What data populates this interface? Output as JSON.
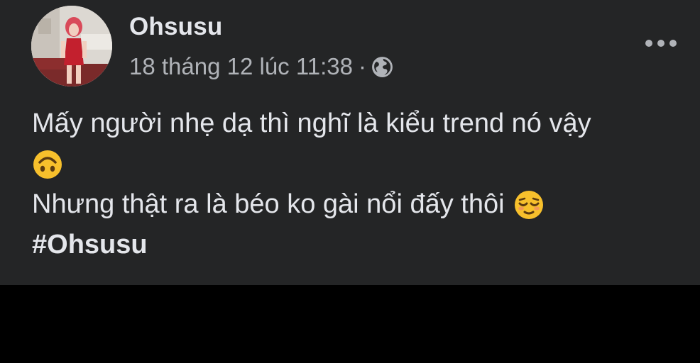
{
  "post": {
    "author": "Ohsusu",
    "timestamp": "18 tháng 12 lúc 11:38",
    "separator": "·",
    "privacy_icon": "globe-icon",
    "more_icon": "more-options-icon",
    "text_line_1": "Mấy người nhẹ dạ thì nghĩ là kiểu trend nó vậy",
    "emoji_1": "upside-down-face",
    "text_line_3": "Nhưng thật ra là béo ko gài nổi đấy thôi",
    "emoji_2": "relieved-face",
    "hashtag": "#Ohsusu"
  },
  "colors": {
    "post_background": "#242526",
    "page_background": "#000000",
    "primary_text": "#e4e6eb",
    "secondary_text": "#b0b3b8",
    "emoji_yellow": "#f7c02c"
  }
}
